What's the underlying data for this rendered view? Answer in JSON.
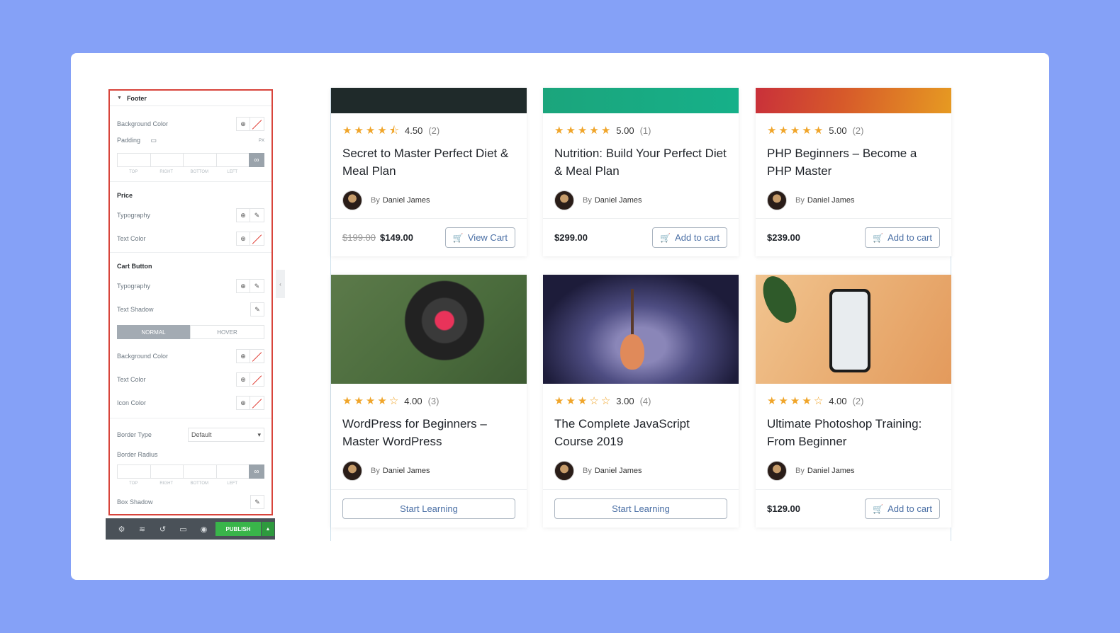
{
  "panel": {
    "section": "Footer",
    "bg_color_label": "Background Color",
    "padding_label": "Padding",
    "units": "PX",
    "dim_labels": [
      "TOP",
      "RIGHT",
      "BOTTOM",
      "LEFT"
    ],
    "price_title": "Price",
    "typography_label": "Typography",
    "text_color_label": "Text Color",
    "cart_title": "Cart Button",
    "text_shadow_label": "Text Shadow",
    "tab_normal": "NORMAL",
    "tab_hover": "HOVER",
    "icon_color_label": "Icon Color",
    "border_type_label": "Border Type",
    "border_type_value": "Default",
    "border_radius_label": "Border Radius",
    "box_shadow_label": "Box Shadow"
  },
  "toolbar": {
    "publish": "PUBLISH"
  },
  "cards": [
    {
      "rating": "4.50",
      "count": "(2)",
      "title": "Secret to Master Perfect Diet & Meal Plan",
      "by": "By",
      "author": "Daniel James",
      "old_price": "$199.00",
      "price": "$149.00",
      "button": "View Cart",
      "stars": 4.5
    },
    {
      "rating": "5.00",
      "count": "(1)",
      "title": "Nutrition: Build Your Perfect Diet & Meal Plan",
      "by": "By",
      "author": "Daniel James",
      "old_price": "",
      "price": "$299.00",
      "button": "Add to cart",
      "stars": 5
    },
    {
      "rating": "5.00",
      "count": "(2)",
      "title": "PHP Beginners – Become a PHP Master",
      "by": "By",
      "author": "Daniel James",
      "old_price": "",
      "price": "$239.00",
      "button": "Add to cart",
      "stars": 5
    },
    {
      "rating": "4.00",
      "count": "(3)",
      "title": "WordPress for Beginners – Master WordPress",
      "by": "By",
      "author": "Daniel James",
      "old_price": "",
      "price": "",
      "button": "Start Learning",
      "stars": 4
    },
    {
      "rating": "3.00",
      "count": "(4)",
      "title": "The Complete JavaScript Course 2019",
      "by": "By",
      "author": "Daniel James",
      "old_price": "",
      "price": "",
      "button": "Start Learning",
      "stars": 3
    },
    {
      "rating": "4.00",
      "count": "(2)",
      "title": "Ultimate Photoshop Training: From Beginner",
      "by": "By",
      "author": "Daniel James",
      "old_price": "",
      "price": "$129.00",
      "button": "Add to cart",
      "stars": 4
    }
  ]
}
